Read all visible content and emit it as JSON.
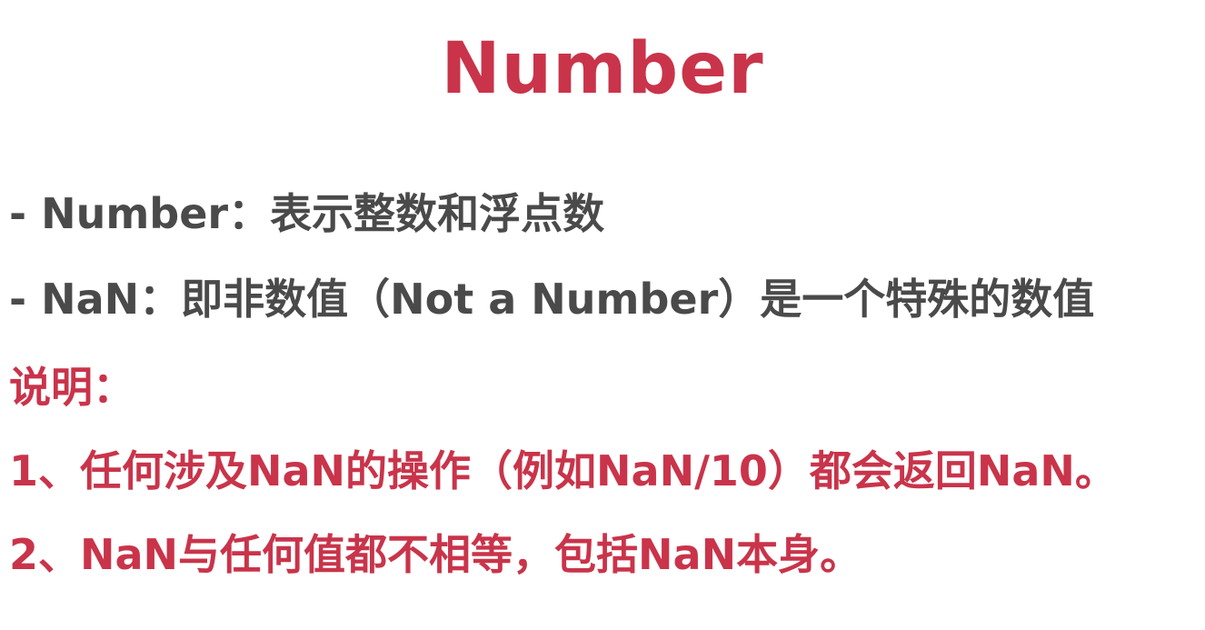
{
  "colors": {
    "accent": "#c9344a",
    "body_text": "#4a4a4a",
    "background": "#ffffff"
  },
  "slide": {
    "title": "Number",
    "lines": [
      "- Number：表示整数和浮点数",
      "- NaN：即非数值（Not a Number）是一个特殊的数值"
    ],
    "note_heading": "说明：",
    "notes": [
      "1、任何涉及NaN的操作（例如NaN/10）都会返回NaN。",
      "2、NaN与任何值都不相等，包括NaN本身。"
    ]
  }
}
